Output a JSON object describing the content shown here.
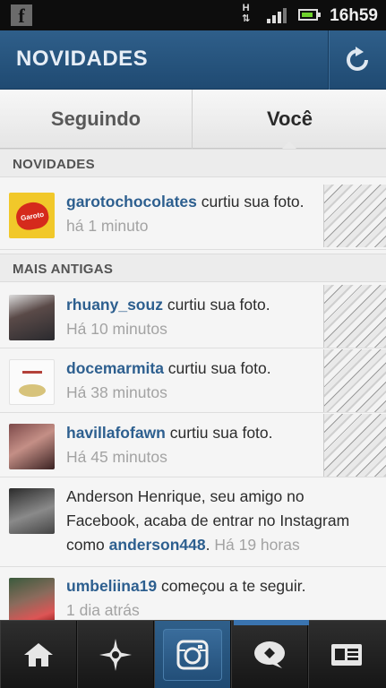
{
  "status_bar": {
    "network_label": "H",
    "time": "16h59"
  },
  "header": {
    "title": "NOVIDADES",
    "refresh_icon": "refresh-icon"
  },
  "tabs": [
    {
      "label": "Seguindo",
      "active": false
    },
    {
      "label": "Você",
      "active": true
    }
  ],
  "sections": {
    "new": "NOVIDADES",
    "older": "MAIS ANTIGAS"
  },
  "feed": {
    "new": [
      {
        "user": "garotochocolates",
        "action": " curtiu sua foto.",
        "time": "há 1 minuto"
      }
    ],
    "older": [
      {
        "user": "rhuany_souz",
        "action": " curtiu sua foto.",
        "time": "Há 10 minutos"
      },
      {
        "user": "docemarmita",
        "action": " curtiu sua foto.",
        "time": "Há 38 minutos"
      },
      {
        "user": "havillafofawn",
        "action": " curtiu sua foto.",
        "time": "Há 45 minutos"
      },
      {
        "prefix": "Anderson Henrique, seu amigo no Facebook, acaba de entrar no Instagram como ",
        "user": "anderson448",
        "suffix": ".",
        "time": "Há 19 horas"
      },
      {
        "user": "umbeliina19",
        "action": " começou a te seguir.",
        "time": "1 dia atrás"
      }
    ]
  },
  "colors": {
    "header_blue": "#2f5f8a",
    "username_blue": "#2d5f8f",
    "timestamp_gray": "#a3a3a3"
  },
  "bottom_nav": [
    {
      "icon": "home-icon",
      "active": false
    },
    {
      "icon": "explore-star-icon",
      "active": false
    },
    {
      "icon": "camera-icon",
      "active": false
    },
    {
      "icon": "news-speech-bubble-icon",
      "active": true
    },
    {
      "icon": "profile-card-icon",
      "active": false
    }
  ]
}
